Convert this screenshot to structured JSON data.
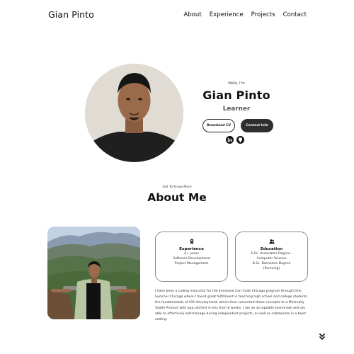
{
  "nav": {
    "logo": "Gian Pinto",
    "links": [
      "About",
      "Experience",
      "Projects",
      "Contact"
    ]
  },
  "hero": {
    "greeting": "Hello, I'm",
    "name": "Gian Pinto",
    "role": "Learner",
    "download_cv": "Download CV",
    "contact_info": "Contact Info",
    "socials": [
      "linkedin-icon",
      "github-icon"
    ]
  },
  "about": {
    "subtitle": "Get To Know More",
    "title": "About Me",
    "experience": {
      "icon": "award-icon",
      "title": "Experience",
      "lines": [
        "4+ years",
        "Software Development",
        "Project Management"
      ]
    },
    "education": {
      "icon": "users-icon",
      "title": "Education",
      "lines": [
        "A.Sc. Associates Degree -",
        "Computer Science",
        "B.Sc. Bachelors Degree",
        "(Pursuing)"
      ]
    },
    "paragraph": "I have been a coding instructor for the Everyone Can Code Chicago program through One Summer Chicago where I found great fulfillment in teaching high school and college students the fundamentals of iOS development, which then converted those concepts to a Minimally Viable Product with app pitched in less than 6 weeks. I am an acceptable teammate and am able to effectively self-manage during independent projects, as well as collaborate in a team setting."
  },
  "scroll_icon": "chevrons-down-icon"
}
